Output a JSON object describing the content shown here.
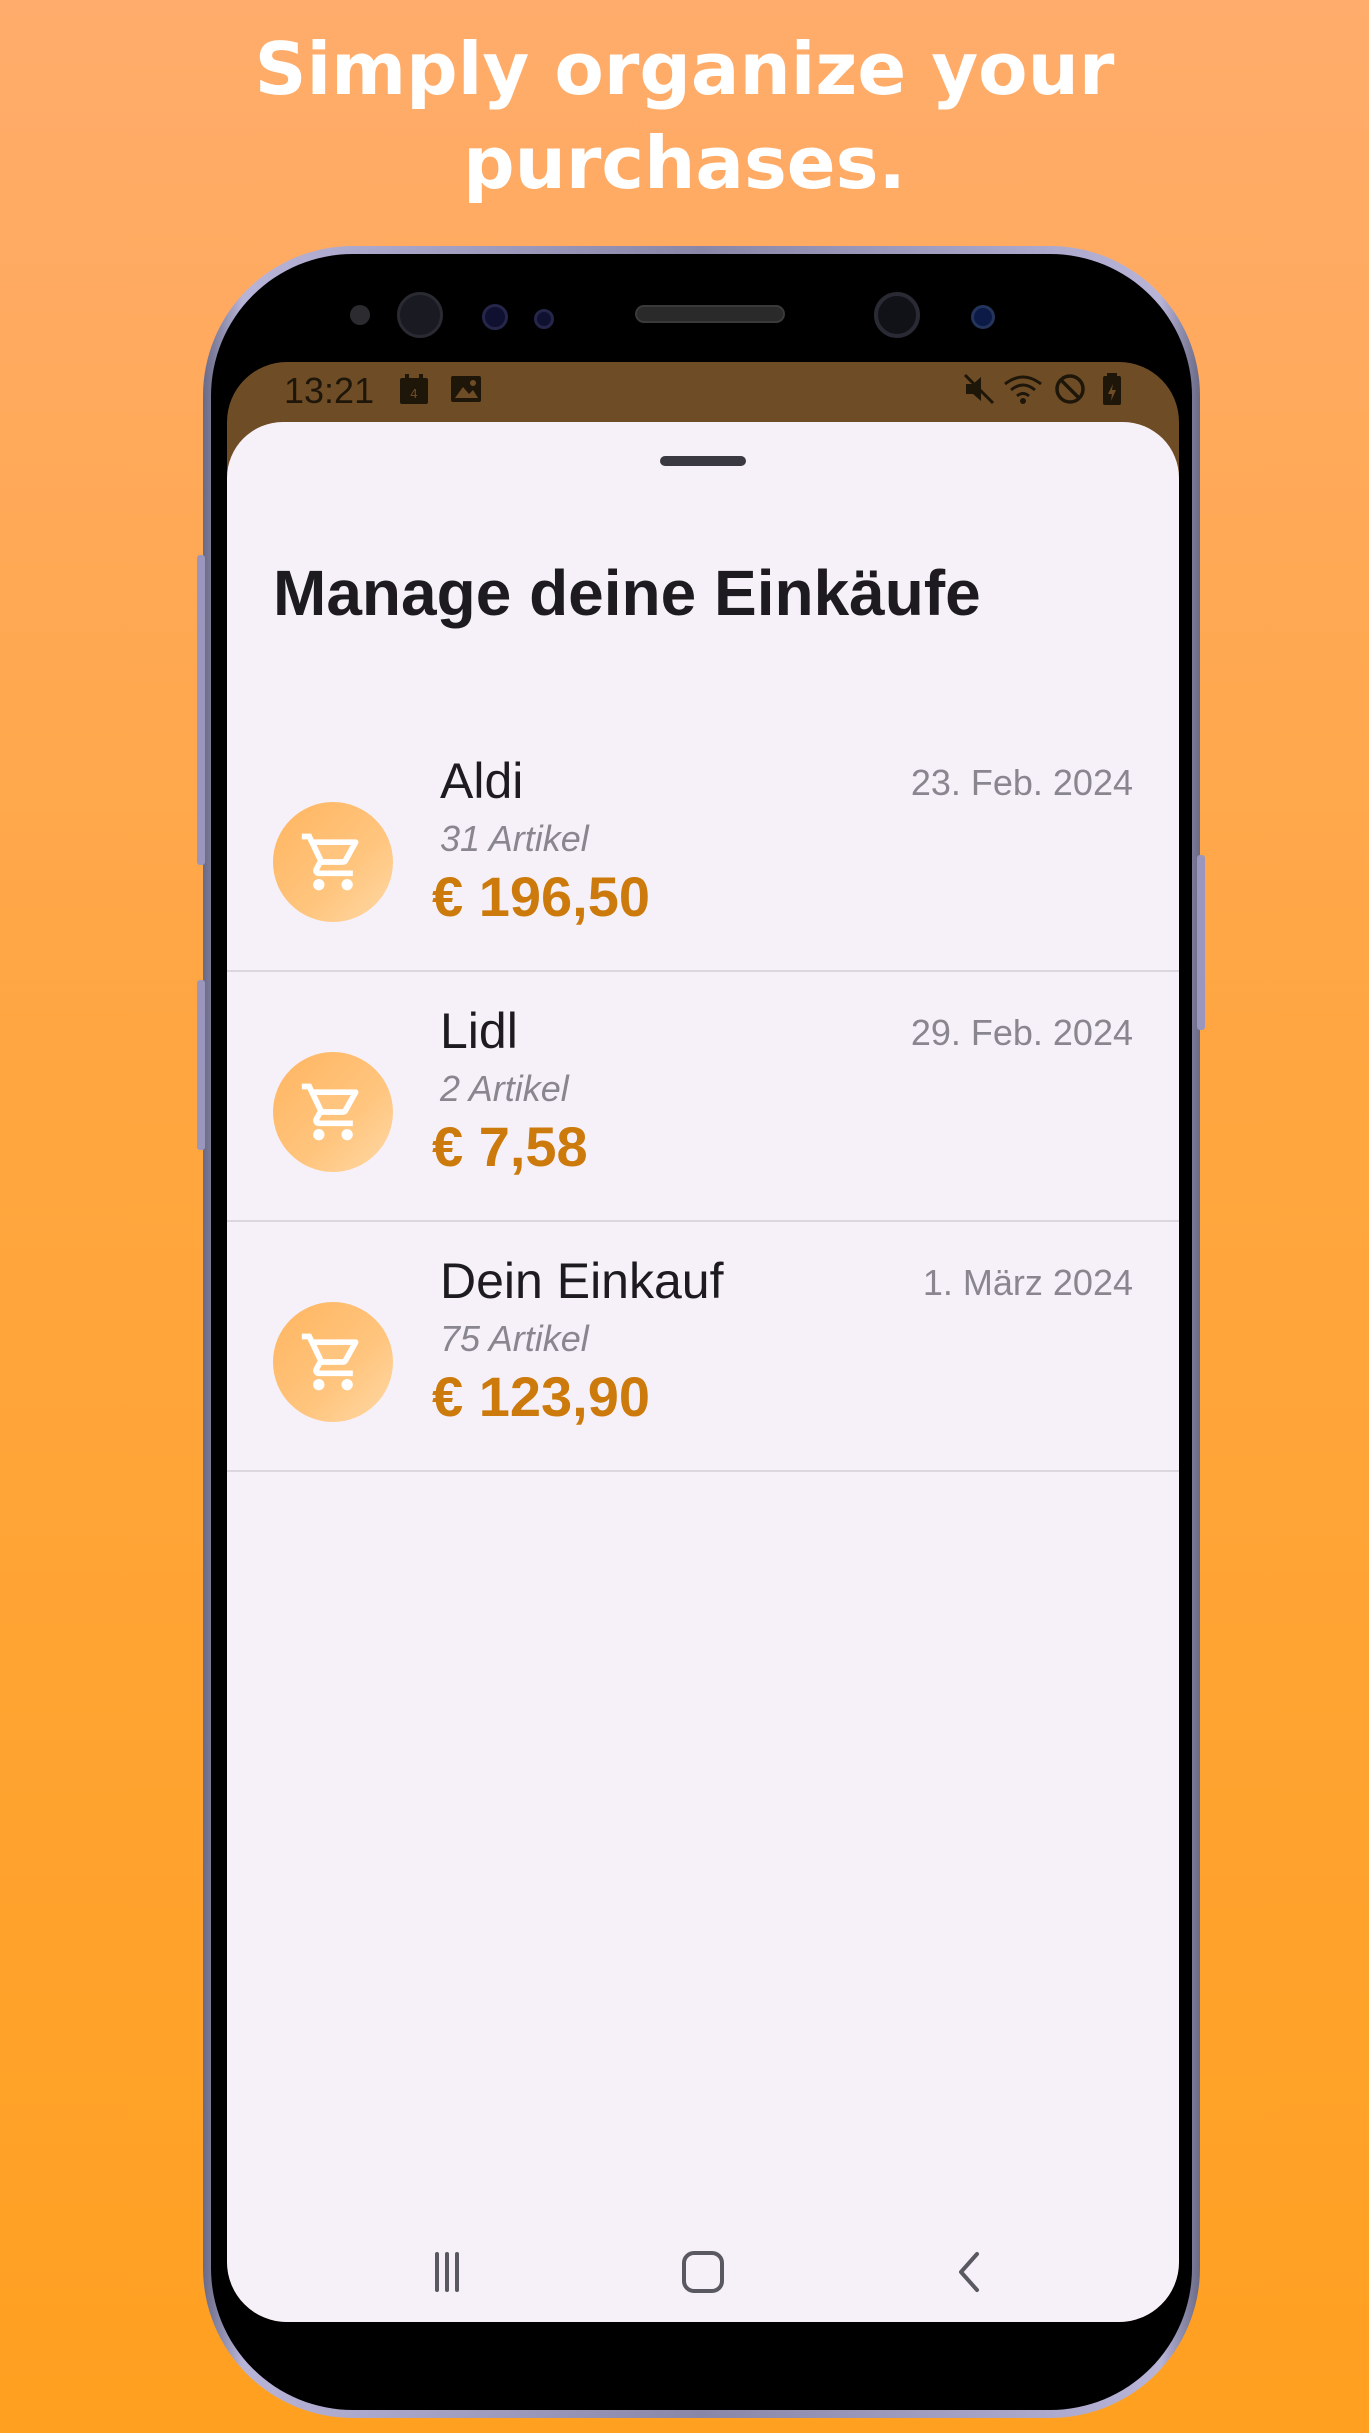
{
  "headline": {
    "line1": "Simply organize your",
    "line2": "purchases."
  },
  "status_bar": {
    "time": "13:21",
    "left_icons": [
      "calendar-icon",
      "image-icon"
    ],
    "right_icons": [
      "mute-icon",
      "wifi-icon",
      "do-not-disturb-icon",
      "battery-icon"
    ]
  },
  "sheet": {
    "title": "Manage deine Einkäufe"
  },
  "purchases": [
    {
      "name": "Aldi",
      "count": "31 Artikel",
      "price": "€ 196,50",
      "date": "23. Feb. 2024",
      "icon": "cart-icon"
    },
    {
      "name": "Lidl",
      "count": "2 Artikel",
      "price": "€ 7,58",
      "date": "29. Feb. 2024",
      "icon": "cart-icon"
    },
    {
      "name": "Dein Einkauf",
      "count": "75 Artikel",
      "price": "€ 123,90",
      "date": "1. März 2024",
      "icon": "cart-icon"
    }
  ],
  "nav": {
    "items": [
      "recent-apps-icon",
      "home-icon",
      "back-icon"
    ]
  },
  "colors": {
    "background_top": "#ffac6c",
    "background_bottom": "#ffa020",
    "price": "#cc7a0c",
    "sheet": "#f6f1f9",
    "avatar": "#ffc57e"
  }
}
